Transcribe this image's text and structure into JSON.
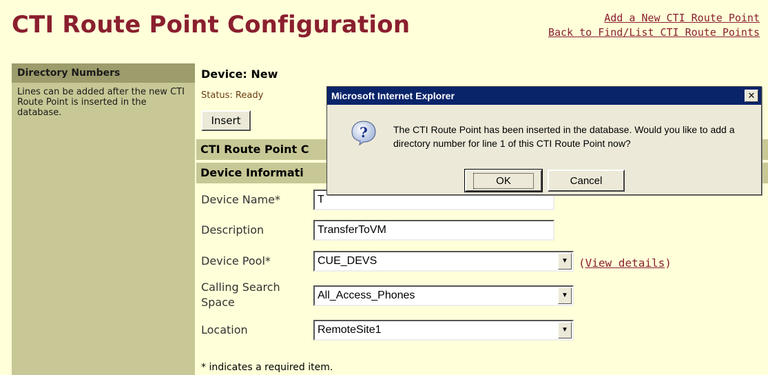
{
  "page": {
    "title": "CTI Route Point Configuration",
    "links": {
      "add_new": "Add a New CTI Route Point",
      "back": "Back to Find/List CTI Route Points"
    }
  },
  "sidebar": {
    "header": "Directory Numbers",
    "text": "Lines can be added after the new CTI Route Point is inserted in the database."
  },
  "device": {
    "title": "Device: New",
    "status": "Status: Ready",
    "insert_label": "Insert"
  },
  "sections": {
    "config": "CTI Route Point C",
    "info": "Device Informati"
  },
  "form": {
    "device_name_label": "Device Name*",
    "device_name_value": "T",
    "description_label": "Description",
    "description_value": "TransferToVM",
    "device_pool_label": "Device Pool*",
    "device_pool_value": "CUE_DEVS",
    "view_details_open": "(",
    "view_details_link": "View details",
    "view_details_close": ")",
    "css_label_line1": "Calling Search",
    "css_label_line2": "Space",
    "css_value": "All_Access_Phones",
    "location_label": "Location",
    "location_value": "RemoteSite1",
    "required_note": "* indicates a required item."
  },
  "dialog": {
    "title": "Microsoft Internet Explorer",
    "close_symbol": "✕",
    "icon": "question-icon",
    "message": "The CTI Route Point has been inserted in the database. Would you like to add a directory number for line 1 of this CTI Route Point now?",
    "ok_label": "OK",
    "cancel_label": "Cancel"
  },
  "colors": {
    "background": "#ffffd9",
    "title": "#8a1f2e",
    "sidebar": "#c8c896",
    "titlebar": "#0a246a"
  }
}
